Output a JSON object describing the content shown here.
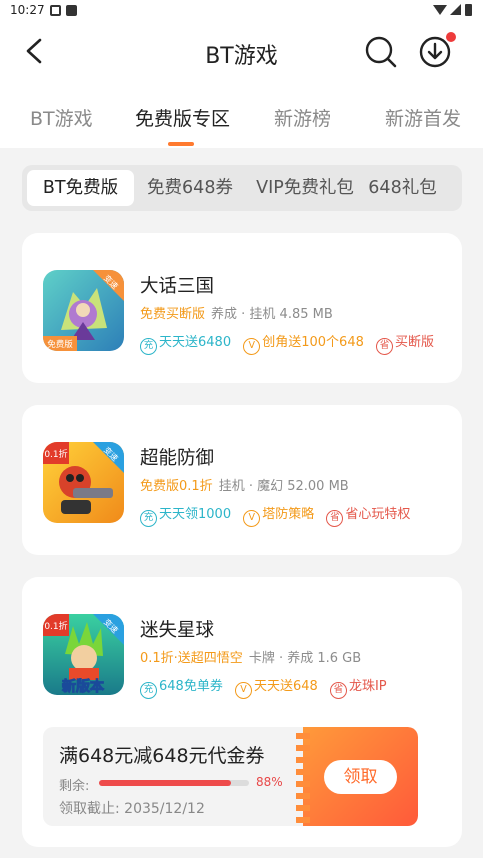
{
  "status_bar": {
    "time": "10:27"
  },
  "header": {
    "title": "BT游戏",
    "back_icon": "back-arrow-icon",
    "search_icon": "search-icon",
    "download_icon": "download-icon"
  },
  "tabs": [
    {
      "label": "BT游戏",
      "active": false
    },
    {
      "label": "免费版专区",
      "active": true
    },
    {
      "label": "新游榜",
      "active": false
    },
    {
      "label": "新游首发",
      "active": false
    }
  ],
  "segments": [
    {
      "label": "BT免费版",
      "active": true
    },
    {
      "label": "免费648券",
      "active": false
    },
    {
      "label": "VIP免费礼包",
      "active": false
    },
    {
      "label": "648礼包",
      "active": false
    }
  ],
  "games": [
    {
      "name": "大话三国",
      "highlight": "免费买断版",
      "meta": "养成 · 挂机  4.85 MB",
      "icon_badge_top": "变速",
      "icon_badge_bottom": "免费版",
      "tags": [
        {
          "icon": "充",
          "text": "天天送6480",
          "color": "cyan"
        },
        {
          "icon": "V",
          "text": "创角送100个648",
          "color": "gold"
        },
        {
          "icon": "省",
          "text": "买断版",
          "color": "red"
        }
      ]
    },
    {
      "name": "超能防御",
      "highlight": "免费版0.1折",
      "meta": "挂机 · 魔幻  52.00 MB",
      "icon_badge_top": "变速",
      "icon_badge_corner": "0.1折",
      "tags": [
        {
          "icon": "充",
          "text": "天天领1000",
          "color": "cyan"
        },
        {
          "icon": "V",
          "text": "塔防策略",
          "color": "gold"
        },
        {
          "icon": "省",
          "text": "省心玩特权",
          "color": "red"
        }
      ]
    },
    {
      "name": "迷失星球",
      "highlight": "0.1折·送超四悟空",
      "meta": "卡牌 · 养成  1.6 GB",
      "icon_badge_top": "变速",
      "icon_badge_corner": "0.1折",
      "icon_banner": "新版本",
      "tags": [
        {
          "icon": "充",
          "text": "648免单券",
          "color": "cyan"
        },
        {
          "icon": "V",
          "text": "天天送648",
          "color": "gold"
        },
        {
          "icon": "省",
          "text": "龙珠IP",
          "color": "red"
        }
      ],
      "coupon": {
        "title": "满648元减648元代金券",
        "remain_label": "剩余:",
        "remain_percent": 88,
        "remain_text": "88%",
        "deadline": "领取截止:  2035/12/12",
        "claim_label": "领取"
      }
    }
  ],
  "colors": {
    "accent_orange": "#ff7a2f",
    "tag_cyan": "#2cb5c9",
    "tag_gold": "#f39a1a",
    "tag_red": "#e4584b",
    "progress_red": "#ee4b4b"
  }
}
